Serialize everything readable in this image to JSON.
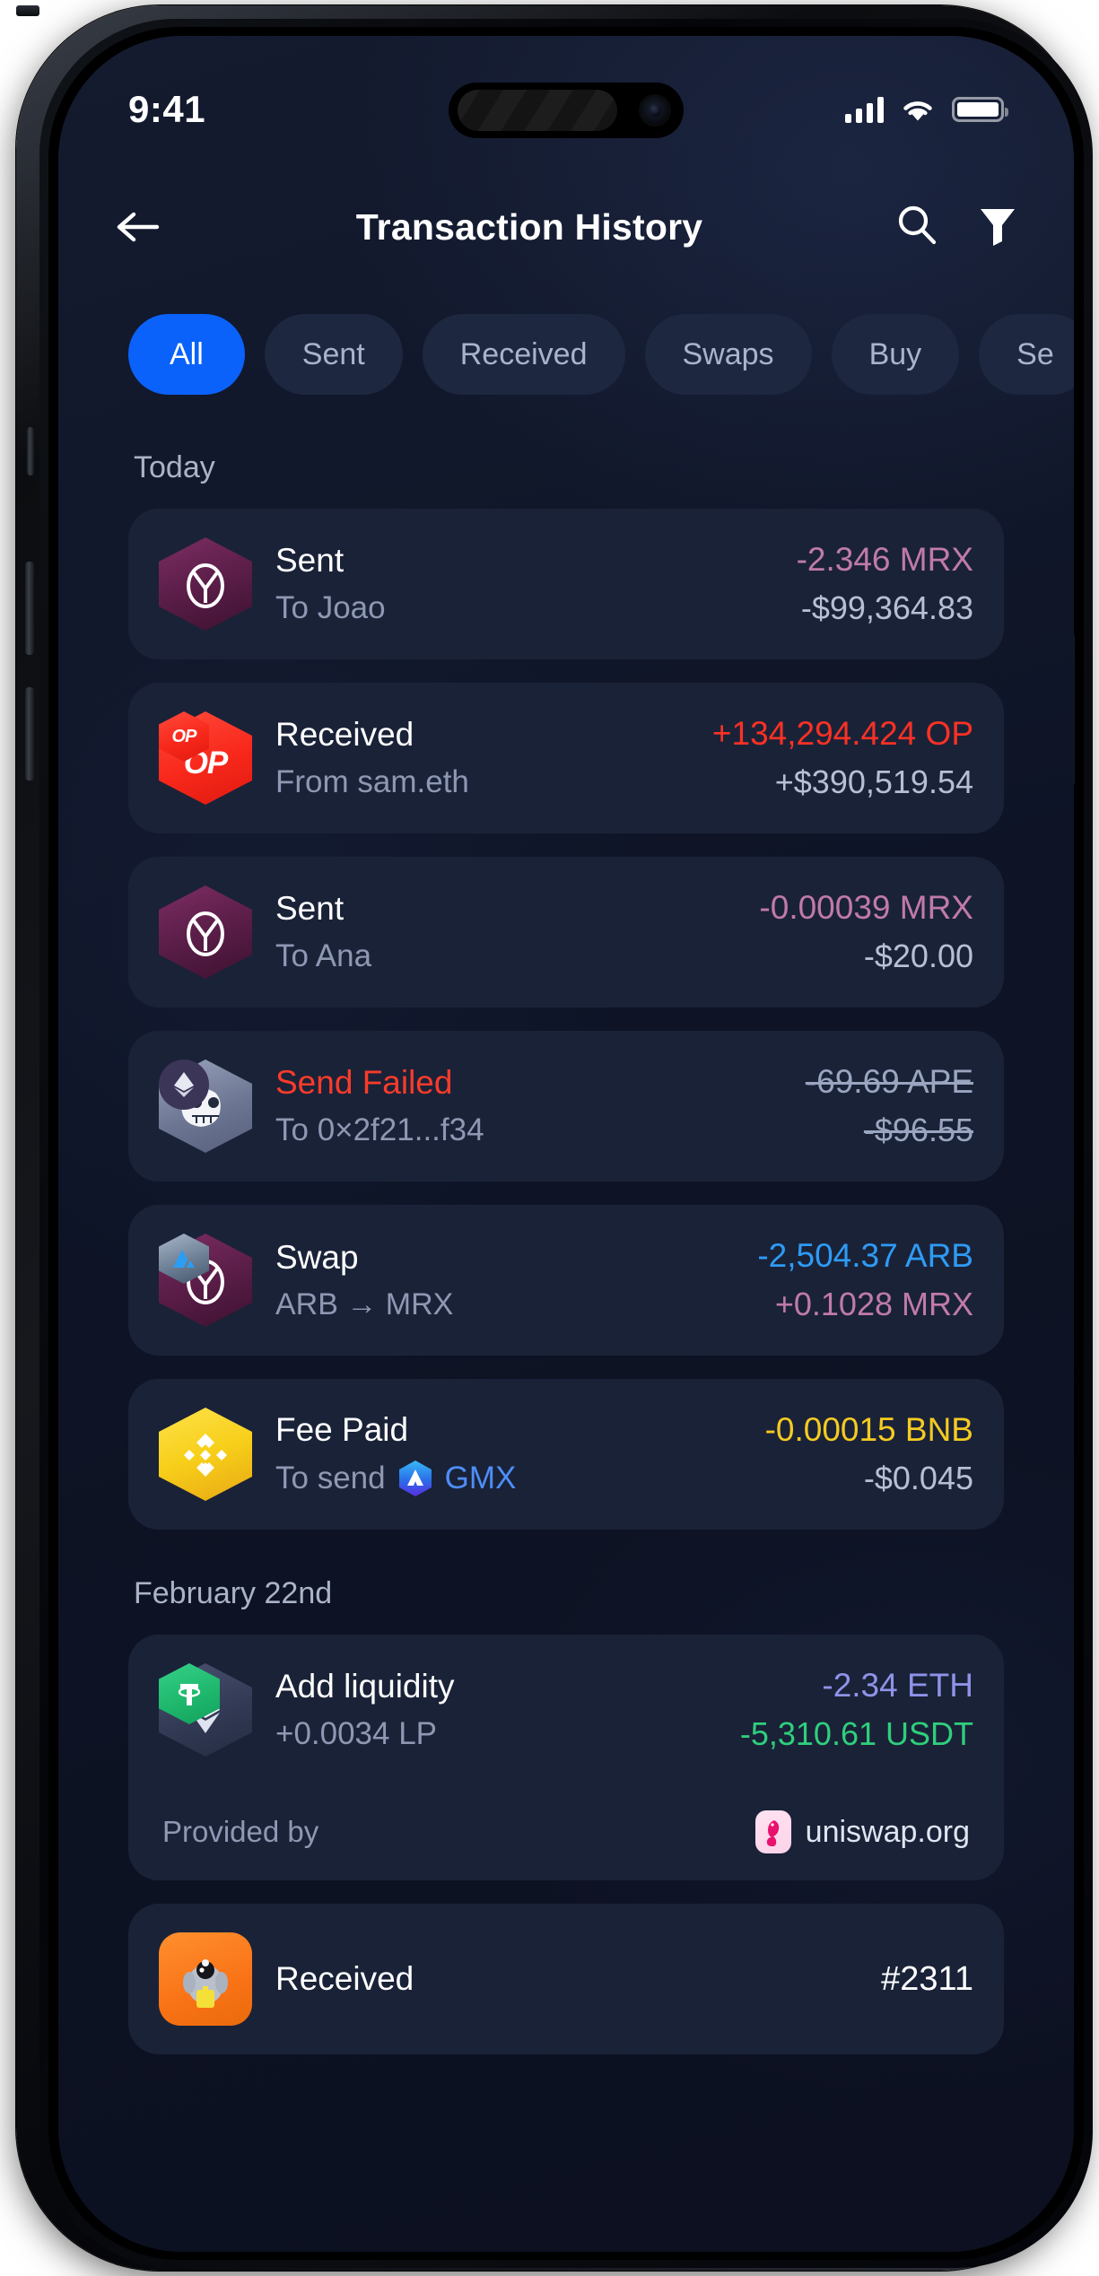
{
  "status_bar": {
    "time": "9:41",
    "cellular_icon": "signal-bars-icon",
    "wifi_icon": "wifi-icon",
    "battery_icon": "battery-full-icon"
  },
  "header": {
    "back_icon": "arrow-left-icon",
    "title": "Transaction History",
    "search_icon": "search-icon",
    "filter_icon": "funnel-filter-icon"
  },
  "filters": {
    "chips": [
      {
        "label": "All",
        "active": true
      },
      {
        "label": "Sent",
        "active": false
      },
      {
        "label": "Received",
        "active": false
      },
      {
        "label": "Swaps",
        "active": false
      },
      {
        "label": "Buy",
        "active": false
      },
      {
        "label": "Se",
        "active": false
      }
    ]
  },
  "sections": [
    {
      "label": "Today",
      "transactions": [
        {
          "icon": "mrx-token-icon",
          "title": "Sent",
          "subtitle": "To Joao",
          "amount": "-2.346 MRX",
          "amount_color": "#c07ba8",
          "fiat": "-$99,364.83",
          "fiat_color": "#b6bfd3"
        },
        {
          "icon": "optimism-token-icon",
          "title": "Received",
          "subtitle": "From sam.eth",
          "amount": "+134,294.424 OP",
          "amount_color": "#fb3124",
          "fiat": "+$390,519.54",
          "fiat_color": "#b6bfd3"
        },
        {
          "icon": "mrx-token-icon",
          "title": "Sent",
          "subtitle": "To Ana",
          "amount": "-0.00039 MRX",
          "amount_color": "#c07ba8",
          "fiat": "-$20.00",
          "fiat_color": "#b6bfd3"
        },
        {
          "icon": "ape-token-icon",
          "title": "Send Failed",
          "title_color": "#fa3b2a",
          "subtitle": "To 0×2f21...f34",
          "amount": "-69.69 APE",
          "amount_color": "#9aa6c0",
          "fiat": "-$96.55",
          "fiat_color": "#9aa6c0",
          "struck": true
        },
        {
          "icon": "mrx-arb-swap-icon",
          "title": "Swap",
          "subtitle": "ARB → MRX",
          "amount": "-2,504.37 ARB",
          "amount_color": "#2e9bf5",
          "fiat": "+0.1028 MRX",
          "fiat_color": "#c07ba8"
        },
        {
          "icon": "bnb-token-icon",
          "title": "Fee Paid",
          "subtitle_prefix": "To send",
          "subtitle_link": "GMX",
          "subtitle_link_icon": "gmx-token-icon",
          "amount": "-0.00015 BNB",
          "amount_color": "#f5cb21",
          "fiat": "-$0.045",
          "fiat_color": "#b6bfd3"
        }
      ]
    },
    {
      "label": "February 22nd",
      "transactions": [
        {
          "icon": "eth-usdt-pair-icon",
          "title": "Add liquidity",
          "subtitle": "+0.0034 LP",
          "amount": "-2.34 ETH",
          "amount_color": "#8f93e8",
          "fiat": "-5,310.61 USDT",
          "fiat_color": "#2fcf7c",
          "footer": {
            "label": "Provided by",
            "provider_icon": "uniswap-icon",
            "provider_name": "uniswap.org"
          }
        },
        {
          "icon": "nft-collection-icon",
          "title": "Received",
          "amount": "#2311",
          "amount_color": "#ffffff"
        }
      ]
    }
  ],
  "theme": {
    "accent": "#0a62fa",
    "screen_bg": "#111729",
    "card_bg": "#1a2238",
    "chip_bg": "#1e2740",
    "muted_text": "#8e98b2"
  }
}
